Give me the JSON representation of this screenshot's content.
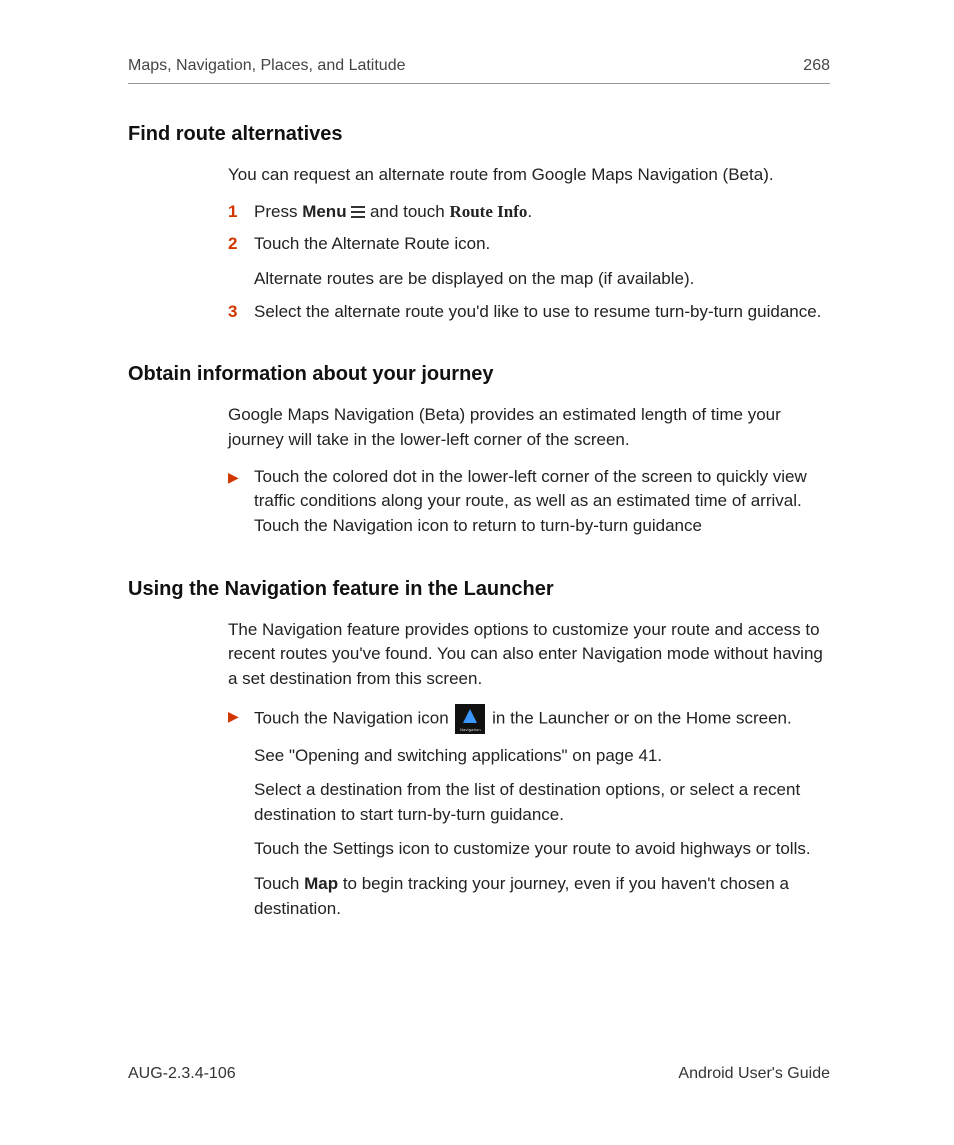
{
  "header": {
    "title": "Maps, Navigation, Places, and Latitude",
    "page_number": "268"
  },
  "section1": {
    "heading": "Find route alternatives",
    "intro": "You can request an alternate route from Google Maps Navigation (Beta).",
    "steps": {
      "n1": "1",
      "s1a": "Press ",
      "s1_menu": "Menu",
      "s1b": " and touch ",
      "s1_routeinfo": "Route Info",
      "s1c": ".",
      "n2": "2",
      "s2": "Touch the Alternate Route icon.",
      "s2_sub": "Alternate routes are be displayed on the map (if available).",
      "n3": "3",
      "s3": "Select the alternate route you'd like to use to resume turn-by-turn guidance."
    }
  },
  "section2": {
    "heading": "Obtain information about your journey",
    "intro": "Google Maps Navigation (Beta) provides an estimated length of time your journey will take in the lower-left corner of the screen.",
    "bullet": "Touch the colored dot in the lower-left corner of the screen to quickly view traffic conditions along your route, as well as an estimated time of arrival. Touch the Navigation icon to return to turn-by-turn guidance"
  },
  "section3": {
    "heading": "Using the Navigation feature in the Launcher",
    "intro": "The Navigation feature provides options to customize your route and access to recent routes you've found. You can also enter Navigation mode without having a set destination from this screen.",
    "b1a": "Touch the Navigation icon ",
    "b1b": " in the Launcher or on the Home screen.",
    "b1_sub": "See \"Opening and switching applications\" on page 41.",
    "p2": "Select a destination from the list of destination options, or select a recent destination to start turn-by-turn guidance.",
    "p3": "Touch the Settings icon to customize your route to avoid highways or tolls.",
    "p4a": "Touch ",
    "p4_map": "Map",
    "p4b": " to begin tracking your journey, even if you haven't chosen a destination."
  },
  "footer": {
    "left": "AUG-2.3.4-106",
    "right": "Android User's Guide"
  }
}
